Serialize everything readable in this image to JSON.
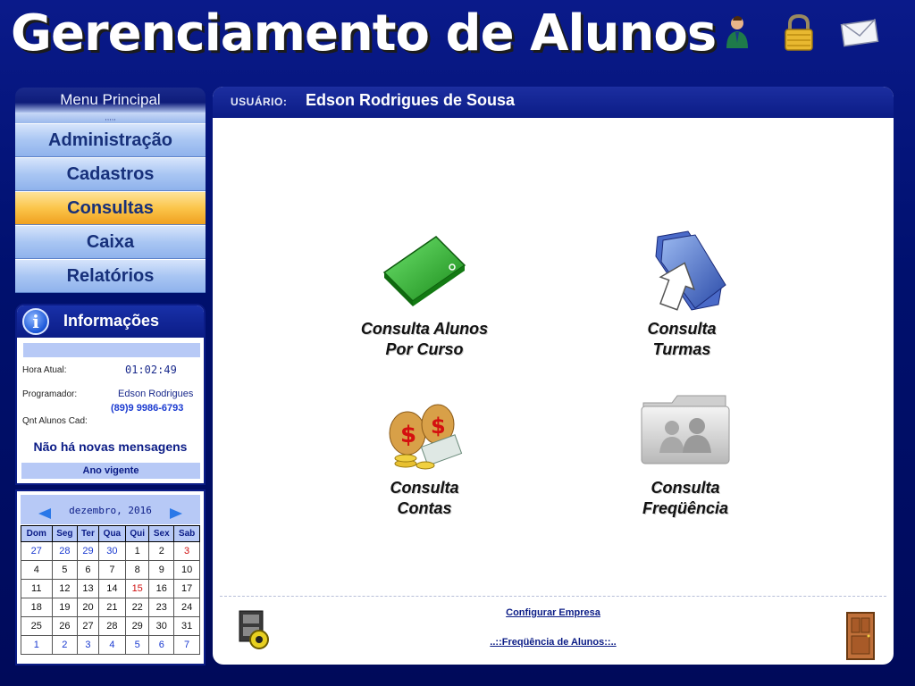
{
  "app": {
    "title": "Gerenciamento de Alunos",
    "top_icons": [
      "user-icon",
      "lock-icon",
      "mail-icon"
    ]
  },
  "menu": {
    "header": "Menu Principal",
    "separator": ",,,,,",
    "items": [
      {
        "label": "Administração"
      },
      {
        "label": "Cadastros"
      },
      {
        "label": "Consultas",
        "active": true
      },
      {
        "label": "Caixa"
      },
      {
        "label": "Relatórios"
      }
    ]
  },
  "info": {
    "title": "Informações",
    "hora_label": "Hora Atual:",
    "hora_value": "01:02:49",
    "programador_label": "Programador:",
    "programador_value": "Edson Rodrigues",
    "phone": "(89)9 9986-6793",
    "qnt_label": "Qnt Alunos Cad:",
    "messages": "Não há novas mensagens",
    "year_label": "Ano vigente"
  },
  "calendar": {
    "title": "dezembro, 2016",
    "weekdays": [
      "Dom",
      "Seg",
      "Ter",
      "Qua",
      "Qui",
      "Sex",
      "Sab"
    ],
    "weeks": [
      [
        "27",
        "28",
        "29",
        "30",
        "1",
        "2",
        "3"
      ],
      [
        "4",
        "5",
        "6",
        "7",
        "8",
        "9",
        "10"
      ],
      [
        "11",
        "12",
        "13",
        "14",
        "15",
        "16",
        "17"
      ],
      [
        "18",
        "19",
        "20",
        "21",
        "22",
        "23",
        "24"
      ],
      [
        "25",
        "26",
        "27",
        "28",
        "29",
        "30",
        "31"
      ],
      [
        "1",
        "2",
        "3",
        "4",
        "5",
        "6",
        "7"
      ]
    ],
    "today": "15"
  },
  "main": {
    "user_label": "USUÁRIO:",
    "user_name": "Edson Rodrigues de Sousa",
    "tiles": [
      {
        "label": "Consulta Alunos\nPor Curso",
        "icon": "green-folder-icon"
      },
      {
        "label": "Consulta\nTurmas",
        "icon": "blue-folder-arrow-icon"
      },
      {
        "label": "Consulta\nContas",
        "icon": "money-bags-icon"
      },
      {
        "label": "Consulta\nFreqüência",
        "icon": "users-folder-icon"
      }
    ],
    "footer": {
      "link1": "Configurar Empresa",
      "link2": "..::Freqüência de Alunos::..",
      "left_icon": "settings-cabinet-icon",
      "right_icon": "exit-door-icon"
    }
  },
  "colors": {
    "background": "#00106e",
    "menu_active": "#fbc54a",
    "accent": "#0b1c86"
  }
}
